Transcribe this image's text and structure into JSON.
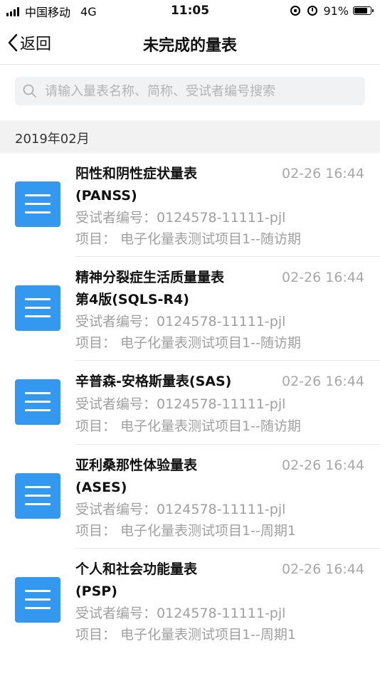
{
  "status_bar": {
    "carrier": "中国移动",
    "network": "4G",
    "time": "11:05",
    "battery": "91%",
    "battery_level": 0.91
  },
  "nav": {
    "back_label": "返回",
    "title": "未完成的量表"
  },
  "search": {
    "placeholder": "请输入量表名称、简称、受试者编号搜索"
  },
  "section": {
    "label": "2019年02月"
  },
  "items": [
    {
      "title_line1": "阳性和阴性症状量表",
      "title_line2": "(PANSS)",
      "time": "02-26 16:44",
      "subject": "受试者编号：0124578-11111-pjl",
      "project": "项目：  电子化量表测试项目1--随访期"
    },
    {
      "title_line1": "精神分裂症生活质量量表",
      "title_line2": "第4版(SQLS-R4)",
      "time": "02-26 16:44",
      "subject": "受试者编号：0124578-11111-pjl",
      "project": "项目：  电子化量表测试项目1--随访期"
    },
    {
      "title_line1": "辛普森-安格斯量表(SAS)",
      "title_line2": "",
      "time": "02-26 16:44",
      "subject": "受试者编号：0124578-11111-pjl",
      "project": "项目：  电子化量表测试项目1--随访期"
    },
    {
      "title_line1": "亚利桑那性体验量表",
      "title_line2": "(ASES)",
      "time": "02-26 16:44",
      "subject": "受试者编号：0124578-11111-pjl",
      "project": "项目：  电子化量表测试项目1--周期1"
    },
    {
      "title_line1": "个人和社会功能量表",
      "title_line2": "(PSP)",
      "time": "02-26 16:44",
      "subject": "受试者编号：0124578-11111-pjl",
      "project": "项目：  电子化量表测试项目1--周期1"
    }
  ],
  "colors": {
    "accent": "#3399f0",
    "secondary_text": "#a0a0a0"
  }
}
